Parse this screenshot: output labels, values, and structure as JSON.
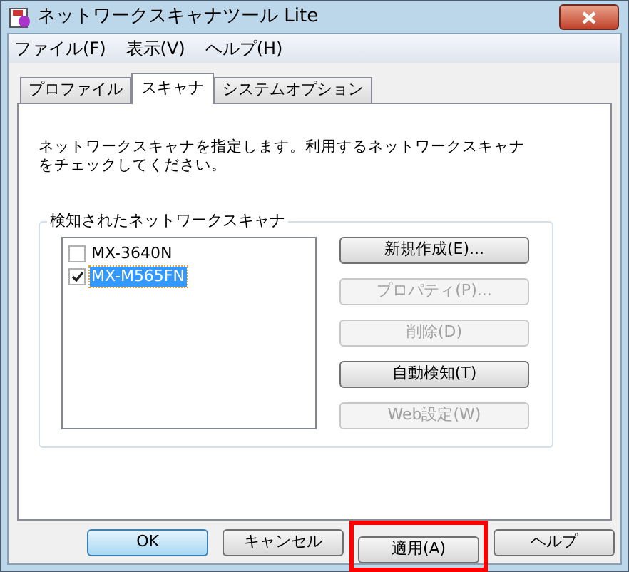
{
  "window": {
    "title": "ネットワークスキャナツール Lite"
  },
  "menu": [
    "ファイル(F)",
    "表示(V)",
    "ヘルプ(H)"
  ],
  "tabs": [
    {
      "label": "プロファイル",
      "selected": false
    },
    {
      "label": "スキャナ",
      "selected": true
    },
    {
      "label": "システムオプション",
      "selected": false
    }
  ],
  "description": "ネットワークスキャナを指定します。利用するネットワークスキャナをチェックしてください。",
  "group": {
    "title": "検知されたネットワークスキャナ",
    "scanners": [
      {
        "name": "MX-3640N",
        "checked": false,
        "selected": false
      },
      {
        "name": "MX-M565FN",
        "checked": true,
        "selected": true
      }
    ],
    "buttons": [
      {
        "label": "新規作成(E)...",
        "disabled": false
      },
      {
        "label": "プロパティ(P)...",
        "disabled": true
      },
      {
        "label": "削除(D)",
        "disabled": true
      },
      {
        "label": "自動検知(T)",
        "disabled": false
      },
      {
        "label": "Web設定(W)",
        "disabled": true
      }
    ]
  },
  "footer_buttons": [
    {
      "label": "OK",
      "default": true,
      "highlighted": false
    },
    {
      "label": "キャンセル",
      "default": false,
      "highlighted": false
    },
    {
      "label": "適用(A)",
      "default": false,
      "highlighted": true
    },
    {
      "label": "ヘルプ",
      "default": false,
      "highlighted": false
    }
  ]
}
